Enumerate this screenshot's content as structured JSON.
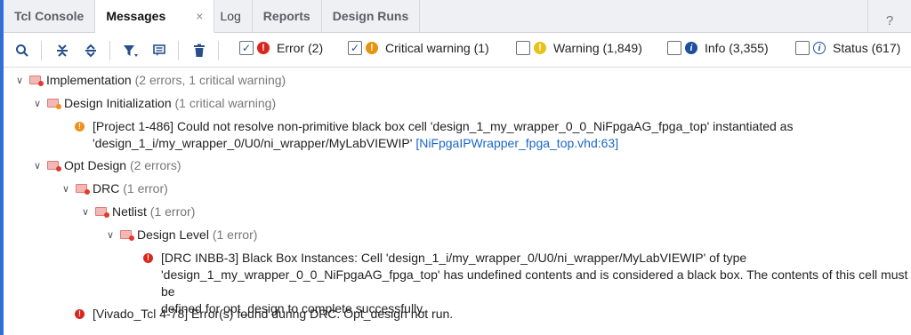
{
  "tabs": [
    {
      "label": "Tcl Console"
    },
    {
      "label": "Messages",
      "close": "×"
    },
    {
      "label": "Log"
    },
    {
      "label": "Reports"
    },
    {
      "label": "Design Runs"
    }
  ],
  "help_label": "?",
  "toolbar": {
    "icons": [
      "search-icon",
      "collapse-all-icon",
      "expand-all-icon",
      "filter-icon",
      "message-icon",
      "delete-icon"
    ],
    "filters": [
      {
        "label": "Error (2)",
        "checked": true,
        "check": "✓",
        "glyph": "!"
      },
      {
        "label": "Critical warning (1)",
        "checked": true,
        "check": "✓",
        "glyph": "!"
      },
      {
        "label": "Warning (1,849)",
        "checked": false,
        "check": "",
        "glyph": "!"
      },
      {
        "label": "Info (3,355)",
        "checked": false,
        "check": "",
        "glyph": "i"
      },
      {
        "label": "Status (617)",
        "checked": false,
        "check": "",
        "glyph": "i"
      }
    ]
  },
  "colors": {
    "error": "#d9261c",
    "critical": "#ef8f1c",
    "warning": "#e8c21a",
    "info": "#1f4f9c",
    "link": "#1a67c9"
  },
  "tree": {
    "implementation": {
      "label": "Implementation",
      "count": "(2 errors, 1 critical warning)"
    },
    "design_init": {
      "label": "Design Initialization",
      "count": "(1 critical warning)"
    },
    "msg1": {
      "line1": "[Project 1-486] Could not resolve non-primitive black box cell 'design_1_my_wrapper_0_0_NiFpgaAG_fpga_top' instantiated as",
      "line2": "'design_1_i/my_wrapper_0/U0/ni_wrapper/MyLabVIEWIP'",
      "link": "[NiFpgaIPWrapper_fpga_top.vhd:63]"
    },
    "opt_design": {
      "label": "Opt Design",
      "count": "(2 errors)"
    },
    "drc": {
      "label": "DRC",
      "count": "(1 error)"
    },
    "netlist": {
      "label": "Netlist",
      "count": "(1 error)"
    },
    "design_level": {
      "label": "Design Level",
      "count": "(1 error)"
    },
    "msg2": {
      "line1": "[DRC INBB-3] Black Box Instances: Cell 'design_1_i/my_wrapper_0/U0/ni_wrapper/MyLabVIEWIP' of type",
      "line2": "'design_1_my_wrapper_0_0_NiFpgaAG_fpga_top' has undefined contents and is considered a black box.  The contents of this cell must be",
      "line3": "defined for opt_design to complete successfully."
    },
    "msg3": {
      "line1": "[Vivado_Tcl 4-78] Error(s) found during DRC. Opt_design not run."
    }
  }
}
